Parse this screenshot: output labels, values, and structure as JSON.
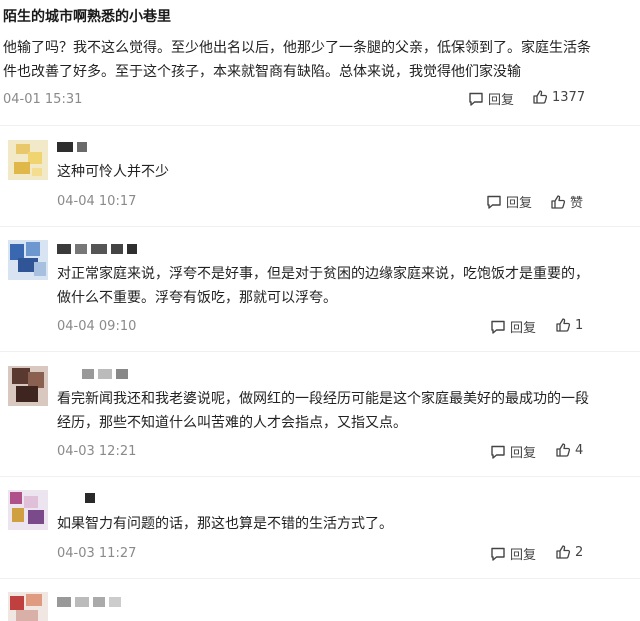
{
  "header": {
    "title": "陌生的城市啊熟悉的小巷里"
  },
  "main_post": {
    "lines": [
      "他输了吗？我不这么觉得。至少他出名以后，他那少了一条腿的父亲，低保领到了。家庭生活条",
      "件也改善了好多。至于这个孩子，本来就智商有缺陷。总体来说，我觉得他们家没输"
    ],
    "time": "04-01 15:31",
    "reply_label": "回复",
    "likes": "1377"
  },
  "comments": [
    {
      "lines": [
        "这种可怜人并不少"
      ],
      "time": "04-04 10:17",
      "reply_label": "回复",
      "like_label": "赞"
    },
    {
      "lines": [
        "对正常家庭来说，浮夸不是好事，但是对于贫困的边缘家庭来说，吃饱饭才是重要的，",
        "做什么不重要。浮夸有饭吃，那就可以浮夸。"
      ],
      "time": "04-04 09:10",
      "reply_label": "回复",
      "like_label": "1"
    },
    {
      "lines": [
        "看完新闻我还和我老婆说呢，做网红的一段经历可能是这个家庭最美好的最成功的一段",
        "经历，那些不知道什么叫苦难的人才会指点，又指又点。"
      ],
      "time": "04-03 12:21",
      "reply_label": "回复",
      "like_label": "4"
    },
    {
      "lines": [
        "如果智力有问题的话，那这也算是不错的生活方式了。"
      ],
      "time": "04-03 11:27",
      "reply_label": "回复",
      "like_label": "2"
    }
  ],
  "icons": {
    "reply": "comment-icon",
    "like": "thumbs-up-icon"
  },
  "colors": {
    "meta": "#8a8a8a",
    "text": "#222222"
  }
}
